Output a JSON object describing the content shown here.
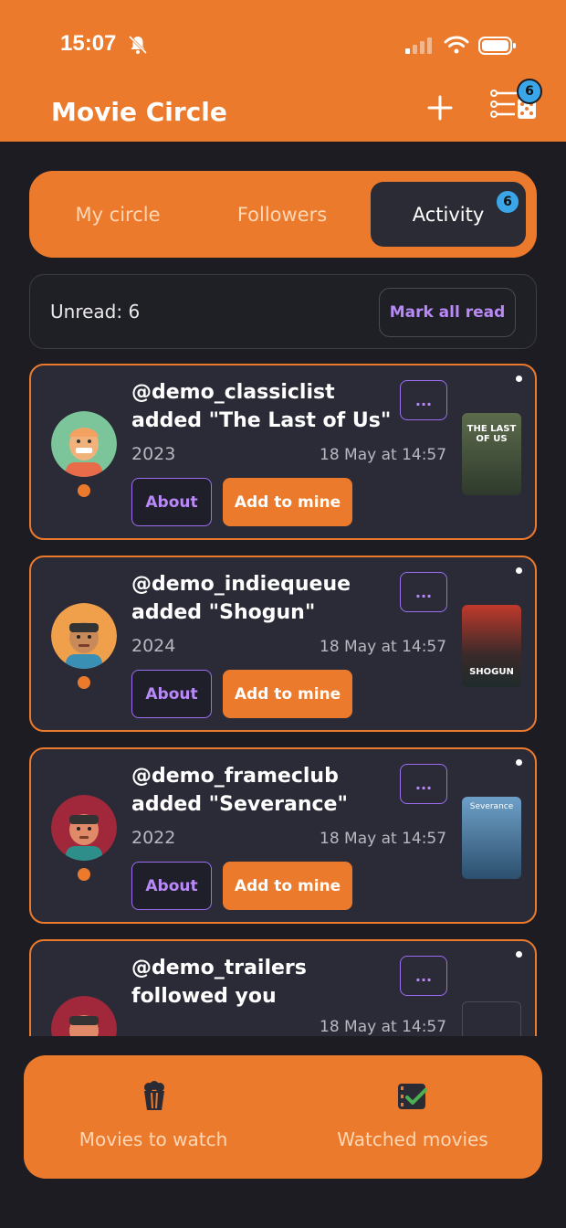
{
  "status_bar": {
    "time": "15:07"
  },
  "header": {
    "title": "Movie Circle",
    "filter_badge": "6"
  },
  "tabs": [
    {
      "label": "My circle"
    },
    {
      "label": "Followers"
    },
    {
      "label": "Activity",
      "badge": "6"
    }
  ],
  "unread": {
    "text": "Unread: 6",
    "mark_all_label": "Mark all read"
  },
  "feed": [
    {
      "user": "@demo_classiclist",
      "action": "added \"The Last of Us\"",
      "year": "2023",
      "time": "18 May at 14:57",
      "more": "...",
      "about": "About",
      "add": "Add to mine",
      "poster_title": "THE LAST OF US",
      "poster_color": "#3b4a3a"
    },
    {
      "user": "@demo_indiequeue",
      "action": "added \"Shogun\"",
      "year": "2024",
      "time": "18 May at 14:57",
      "more": "...",
      "about": "About",
      "add": "Add to mine",
      "poster_title": "SHOGUN",
      "poster_color": "#b32d2d"
    },
    {
      "user": "@demo_frameclub",
      "action": "added \"Severance\"",
      "year": "2022",
      "time": "18 May at 14:57",
      "more": "...",
      "about": "About",
      "add": "Add to mine",
      "poster_title": "Severance",
      "poster_color": "#5f8fb5"
    },
    {
      "user": "@demo_trailers",
      "action": "followed you",
      "time": "18 May at 14:57",
      "more": "..."
    }
  ],
  "bottom_nav": [
    {
      "label": "Movies to watch",
      "icon": "popcorn-icon"
    },
    {
      "label": "Watched movies",
      "icon": "film-check-icon"
    }
  ],
  "colors": {
    "accent": "#ec7a2c",
    "purple": "#b889f7",
    "badge": "#3aa6e8",
    "card_bg": "#2b2b38"
  }
}
